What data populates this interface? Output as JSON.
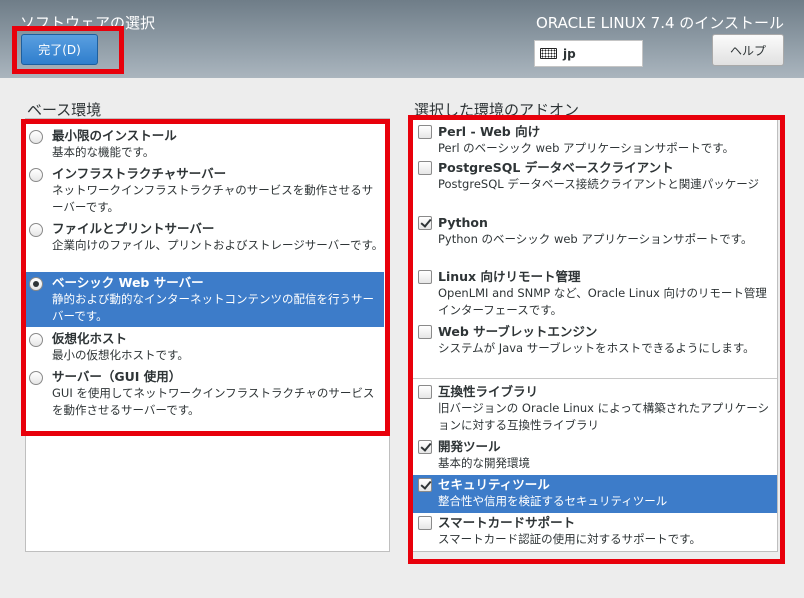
{
  "header": {
    "title": "ソフトウェアの選択",
    "product": "ORACLE LINUX 7.4 のインストール",
    "done_label": "完了(D)",
    "keyboard_layout": "jp",
    "help_label": "ヘルプ"
  },
  "base_env": {
    "label": "ベース環境",
    "selected": "ベーシック Web サーバー",
    "items": [
      {
        "name": "最小限のインストール",
        "desc": "基本的な機能です。",
        "selected": false
      },
      {
        "name": "インフラストラクチャサーバー",
        "desc": "ネットワークインフラストラクチャのサービスを動作させるサーバーです。",
        "selected": false
      },
      {
        "name": "ファイルとプリントサーバー",
        "desc": "企業向けのファイル、プリントおよびストレージサーバーです。",
        "selected": false
      },
      {
        "name": "ベーシック Web サーバー",
        "desc": "静的および動的なインターネットコンテンツの配信を行うサーバーです。",
        "selected": true
      },
      {
        "name": "仮想化ホスト",
        "desc": "最小の仮想化ホストです。",
        "selected": false
      },
      {
        "name": "サーバー（GUI 使用）",
        "desc": "GUI を使用してネットワークインフラストラクチャのサービスを動作させるサーバーです。",
        "selected": false
      }
    ]
  },
  "addons": {
    "label": "選択した環境のアドオン",
    "items": [
      {
        "name": "Perl - Web 向け",
        "desc": "Perl のベーシック web アプリケーションサポートです。",
        "checked": false,
        "selected": false
      },
      {
        "name": "PostgreSQL データベースクライアント",
        "desc": "PostgreSQL データベース接続クライアントと関連パッケージ",
        "checked": false,
        "selected": false
      },
      {
        "name": "Python",
        "desc": "Python のベーシック web アプリケーションサポートです。",
        "checked": true,
        "selected": false
      },
      {
        "name": "Linux 向けリモート管理",
        "desc": "OpenLMI and SNMP など、Oracle Linux 向けのリモート管理インターフェースです。",
        "checked": false,
        "selected": false
      },
      {
        "name": "Web サーブレットエンジン",
        "desc": "システムが Java サーブレットをホストできるようにします。",
        "checked": false,
        "selected": false
      },
      {
        "name": "互換性ライブラリ",
        "desc": "旧バージョンの Oracle Linux によって構築されたアプリケーションに対する互換性ライブラリ",
        "checked": false,
        "selected": false
      },
      {
        "name": "開発ツール",
        "desc": "基本的な開発環境",
        "checked": true,
        "selected": false
      },
      {
        "name": "セキュリティツール",
        "desc": "整合性や信用を検証するセキュリティツール",
        "checked": true,
        "selected": true
      },
      {
        "name": "スマートカードサポート",
        "desc": "スマートカード認証の使用に対するサポートです。",
        "checked": false,
        "selected": false
      }
    ]
  }
}
